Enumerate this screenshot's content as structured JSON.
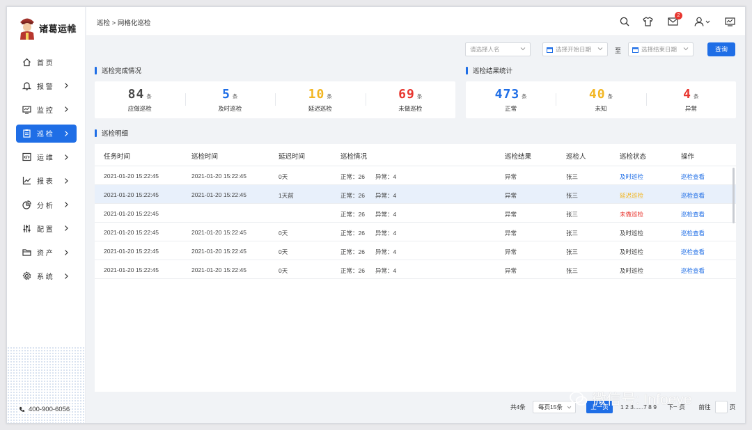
{
  "app": {
    "logo_text": "诸葛运帷",
    "phone": "400-900-6056"
  },
  "sidebar": {
    "items": [
      {
        "label": "首 页",
        "icon": "home-icon",
        "has_chevron": false,
        "active": false
      },
      {
        "label": "报 警",
        "icon": "bell-icon",
        "has_chevron": true,
        "active": false
      },
      {
        "label": "监 控",
        "icon": "monitor-icon",
        "has_chevron": true,
        "active": false
      },
      {
        "label": "巡 检",
        "icon": "clipboard-icon",
        "has_chevron": true,
        "active": true
      },
      {
        "label": "运 维",
        "icon": "code-window-icon",
        "has_chevron": true,
        "active": false
      },
      {
        "label": "报 表",
        "icon": "line-chart-icon",
        "has_chevron": true,
        "active": false
      },
      {
        "label": "分 析",
        "icon": "pie-chart-icon",
        "has_chevron": true,
        "active": false
      },
      {
        "label": "配 置",
        "icon": "sliders-icon",
        "has_chevron": true,
        "active": false
      },
      {
        "label": "资 产",
        "icon": "folder-icon",
        "has_chevron": true,
        "active": false
      },
      {
        "label": "系 统",
        "icon": "gear-icon",
        "has_chevron": true,
        "active": false
      }
    ]
  },
  "header": {
    "breadcrumb": "巡检 > 网格化巡检",
    "mail_badge": "2"
  },
  "filters": {
    "person_placeholder": "请选择人名",
    "start_placeholder": "选择开始日期",
    "to_label": "至",
    "end_placeholder": "选择结束日期",
    "query_label": "查询"
  },
  "completion": {
    "title": "巡检完成情况",
    "stats": [
      {
        "value": "84",
        "unit": "条",
        "label": "应做巡检",
        "color": "#4a4a4a"
      },
      {
        "value": "5",
        "unit": "条",
        "label": "及时巡检",
        "color": "#1f6ee6"
      },
      {
        "value": "10",
        "unit": "条",
        "label": "延迟巡检",
        "color": "#f2b622"
      },
      {
        "value": "69",
        "unit": "条",
        "label": "未做巡检",
        "color": "#e8362f"
      }
    ]
  },
  "results": {
    "title": "巡检结果统计",
    "stats": [
      {
        "value": "473",
        "unit": "条",
        "label": "正常",
        "color": "#1f6ee6"
      },
      {
        "value": "40",
        "unit": "条",
        "label": "未知",
        "color": "#f2b622"
      },
      {
        "value": "4",
        "unit": "条",
        "label": "异常",
        "color": "#e8362f"
      }
    ]
  },
  "detail": {
    "title": "巡检明细",
    "columns": [
      "任务时间",
      "巡检时间",
      "延迟时间",
      "巡检情况",
      "巡检结果",
      "巡检人",
      "巡检状态",
      "操作"
    ],
    "rows": [
      {
        "task_time": "2021-01-20 15:22:45",
        "check_time": "2021-01-20 15:22:45",
        "delay": "0天",
        "normal": "正常：26",
        "abnormal": "异常：4",
        "result": "异常",
        "person": "张三",
        "status": "及时巡检",
        "status_color": "#1f6ee6",
        "action": "巡检查看",
        "highlight": false
      },
      {
        "task_time": "2021-01-20 15:22:45",
        "check_time": "2021-01-20 15:22:45",
        "delay": "1天前",
        "normal": "正常：26",
        "abnormal": "异常：4",
        "result": "异常",
        "person": "张三",
        "status": "延迟巡检",
        "status_color": "#f2b622",
        "action": "巡检查看",
        "highlight": true
      },
      {
        "task_time": "2021-01-20 15:22:45",
        "check_time": "",
        "delay": "",
        "normal": "正常：26",
        "abnormal": "异常：4",
        "result": "异常",
        "person": "张三",
        "status": "未做巡检",
        "status_color": "#e8362f",
        "action": "巡检查看",
        "highlight": false
      },
      {
        "task_time": "2021-01-20 15:22:45",
        "check_time": "2021-01-20 15:22:45",
        "delay": "0天",
        "normal": "正常：26",
        "abnormal": "异常：4",
        "result": "异常",
        "person": "张三",
        "status": "及时巡检",
        "status_color": "#444444",
        "action": "巡检查看",
        "highlight": false
      },
      {
        "task_time": "2021-01-20 15:22:45",
        "check_time": "2021-01-20 15:22:45",
        "delay": "0天",
        "normal": "正常：26",
        "abnormal": "异常：4",
        "result": "异常",
        "person": "张三",
        "status": "及时巡检",
        "status_color": "#444444",
        "action": "巡检查看",
        "highlight": false
      },
      {
        "task_time": "2021-01-20 15:22:45",
        "check_time": "2021-01-20 15:22:45",
        "delay": "0天",
        "normal": "正常：26",
        "abnormal": "异常：4",
        "result": "异常",
        "person": "张三",
        "status": "及时巡检",
        "status_color": "#444444",
        "action": "巡检查看",
        "highlight": false
      }
    ]
  },
  "pagination": {
    "total": "共4条",
    "per_page": "每页15条",
    "prev": "上一页",
    "pages": "1 2 3......7 8 9",
    "next": "下一页",
    "goto": "前往",
    "page_suffix": "页"
  },
  "watermark": {
    "text": "微信号: Infoeye"
  }
}
